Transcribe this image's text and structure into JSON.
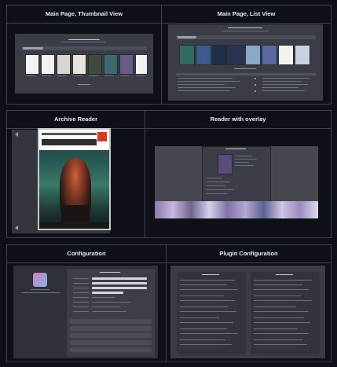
{
  "panels": {
    "main_thumb": {
      "title": "Main Page, Thumbnail View"
    },
    "main_list": {
      "title": "Main Page, List View"
    },
    "reader": {
      "title": "Archive Reader"
    },
    "reader_overlay": {
      "title": "Reader with overlay"
    },
    "config": {
      "title": "Configuration"
    },
    "plugin_config": {
      "title": "Plugin Configuration"
    }
  },
  "colors": {
    "page_bg": "#0d1117",
    "border": "#3d444d",
    "screenshot_bg": "#3a3d46",
    "accent_red": "#d73a22"
  }
}
